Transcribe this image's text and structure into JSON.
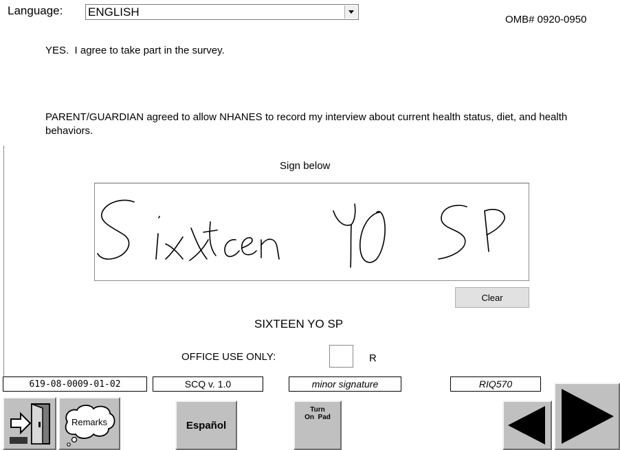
{
  "header": {
    "language_label": "Language:",
    "language_value": "ENGLISH",
    "omb_number": "OMB# 0920-0950"
  },
  "consent": {
    "agree_text": "YES.  I agree to take part in the survey.",
    "parent_text": "PARENT/GUARDIAN agreed to allow NHANES to record my interview about current health status, diet, and health behaviors."
  },
  "signature": {
    "sign_label": "Sign below",
    "handwriting": "Sixteen YO SP",
    "clear_label": "Clear",
    "printed_name": "SIXTEEN YO SP"
  },
  "office": {
    "label": "OFFICE USE ONLY:",
    "r_label": "R"
  },
  "status_bar": {
    "case_id": "619-08-0009-01-02",
    "version": "SCQ v. 1.0",
    "form_type": "minor signature",
    "question_code": "RIQ570"
  },
  "toolbar": {
    "exit_icon": "exit-door-icon",
    "remarks_label": "Remarks",
    "espanol_label": "Español",
    "pad_label_line1": "Turn",
    "pad_label_line2": "On  Pad",
    "prev_icon": "arrow-left-icon",
    "next_icon": "arrow-right-icon"
  }
}
